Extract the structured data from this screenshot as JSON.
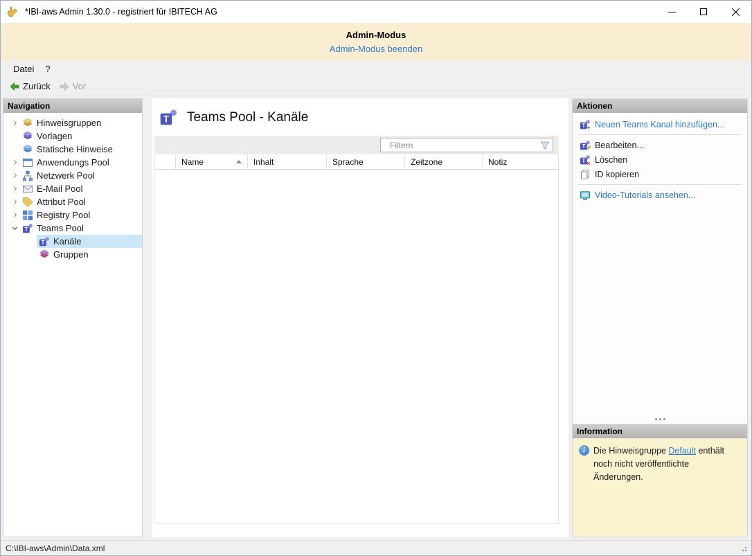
{
  "window": {
    "title": "*IBI-aws Admin 1.30.0 - registriert für IBITECH AG"
  },
  "banner": {
    "title": "Admin-Modus",
    "link_label": "Admin-Modus beenden"
  },
  "menubar": {
    "items": [
      {
        "label": "Datei",
        "name": "datei"
      },
      {
        "label": "?",
        "name": "help"
      }
    ]
  },
  "toolbar": {
    "back_label": "Zurück",
    "forward_label": "Vor"
  },
  "navigation": {
    "header": "Navigation",
    "items": [
      {
        "label": "Hinweisgruppen",
        "icon": "layers-gold-icon",
        "expand": "collapsed",
        "level": 0,
        "selected": false
      },
      {
        "label": "Vorlagen",
        "icon": "layers-purple-icon",
        "expand": "none",
        "level": 0,
        "selected": false
      },
      {
        "label": "Statische Hinweise",
        "icon": "layers-blue-icon",
        "expand": "none",
        "level": 0,
        "selected": false
      },
      {
        "label": "Anwendungs Pool",
        "icon": "app-window-icon",
        "expand": "collapsed",
        "level": 0,
        "selected": false
      },
      {
        "label": "Netzwerk Pool",
        "icon": "network-icon",
        "expand": "collapsed",
        "level": 0,
        "selected": false
      },
      {
        "label": "E-Mail Pool",
        "icon": "email-icon",
        "expand": "collapsed",
        "level": 0,
        "selected": false
      },
      {
        "label": "Attribut Pool",
        "icon": "attribute-tag-icon",
        "expand": "collapsed",
        "level": 0,
        "selected": false
      },
      {
        "label": "Registry Pool",
        "icon": "registry-grid-icon",
        "expand": "collapsed",
        "level": 0,
        "selected": false
      },
      {
        "label": "Teams Pool",
        "icon": "teams-icon",
        "expand": "expanded",
        "level": 0,
        "selected": false
      },
      {
        "label": "Kanäle",
        "icon": "teams-icon",
        "expand": "none",
        "level": 1,
        "selected": true
      },
      {
        "label": "Gruppen",
        "icon": "layers-magenta-icon",
        "expand": "none",
        "level": 1,
        "selected": false
      }
    ]
  },
  "main": {
    "title": "Teams Pool - Kanäle",
    "filter": {
      "placeholder": "Filtern"
    },
    "table": {
      "columns": [
        {
          "label": "Name",
          "sorted": "asc"
        },
        {
          "label": "Inhalt"
        },
        {
          "label": "Sprache"
        },
        {
          "label": "Zeitzone"
        },
        {
          "label": "Notiz"
        }
      ],
      "rows": []
    }
  },
  "actions": {
    "header": "Aktionen",
    "groups": [
      {
        "items": [
          {
            "label": "Neuen Teams Kanal hinzufügen...",
            "icon": "teams-add-icon",
            "link": true
          }
        ]
      },
      {
        "items": [
          {
            "label": "Bearbeiten...",
            "icon": "teams-edit-icon",
            "link": false
          },
          {
            "label": "Löschen",
            "icon": "teams-delete-icon",
            "link": false
          },
          {
            "label": "ID kopieren",
            "icon": "copy-icon",
            "link": false
          }
        ]
      },
      {
        "items": [
          {
            "label": "Video-Tutorials ansehen...",
            "icon": "tv-icon",
            "link": true
          }
        ]
      }
    ]
  },
  "information": {
    "header": "Information",
    "message": {
      "before": "Die Hinweisgruppe ",
      "link": "Default",
      "after": " enthält noch nicht veröffentlichte Änderungen."
    }
  },
  "statusbar": {
    "path": "C:\\IBI-aws\\Admin\\Data.xml"
  },
  "colors": {
    "accent_link": "#2b7cd3",
    "banner_bg": "#f9edd2",
    "selection_bg": "#cbe8fa",
    "info_bg": "#faf3cf",
    "panel_header_bg": "#bfbfbf"
  }
}
